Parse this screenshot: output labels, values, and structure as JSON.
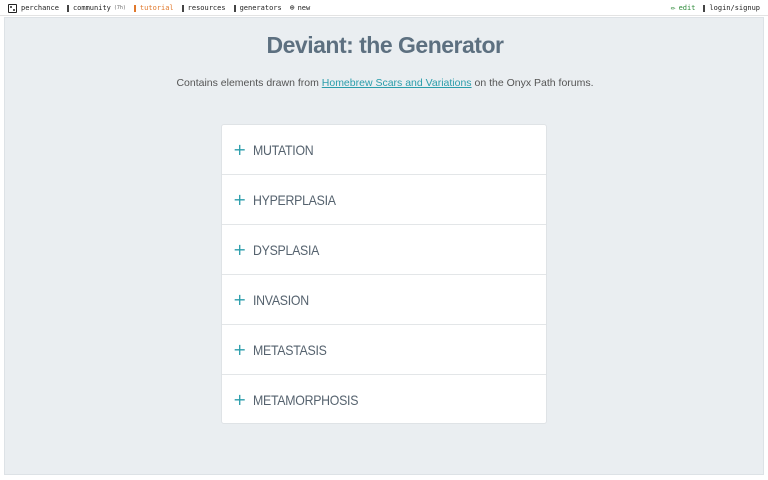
{
  "nav": {
    "brand": "perchance",
    "community": "community",
    "community_count": "(7h)",
    "tutorial": "tutorial",
    "resources": "resources",
    "generators": "generators",
    "new": "new",
    "edit": "edit",
    "login": "login/signup"
  },
  "page": {
    "title": "Deviant: the Generator",
    "subtitle_prefix": "Contains elements drawn from",
    "subtitle_link": "Homebrew Scars and Variations",
    "subtitle_suffix": "on the Onyx Path forums."
  },
  "accordion": {
    "expand_glyph": "+",
    "items": [
      {
        "label": "MUTATION"
      },
      {
        "label": "HYPERPLASIA"
      },
      {
        "label": "DYSPLASIA"
      },
      {
        "label": "INVASION"
      },
      {
        "label": "METASTASIS"
      },
      {
        "label": "METAMORPHOSIS"
      }
    ]
  }
}
